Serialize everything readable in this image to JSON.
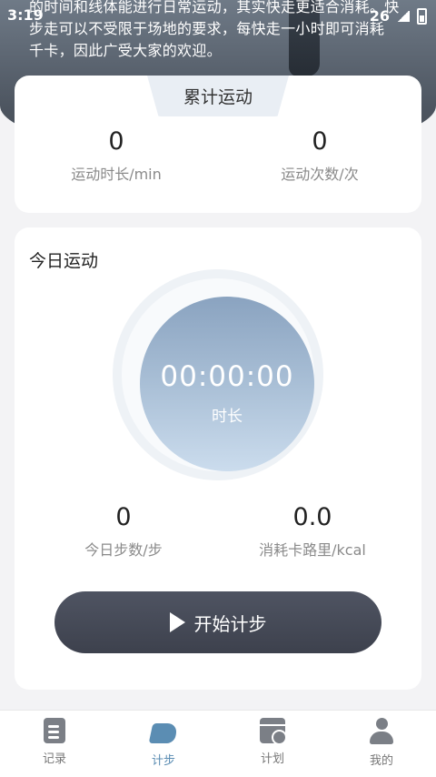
{
  "status_bar": {
    "time": "3:19",
    "signal": "26"
  },
  "hero": {
    "text_line1": "的时间和线体能进行日常运动，其实快走更适合消耗。快",
    "text_line2": "步走可以不受限于场地的要求，每快走一小时即可消耗",
    "text_line3": "千卡，因此广受大家的欢迎。"
  },
  "cumulative": {
    "title": "累计运动",
    "duration_value": "0",
    "duration_label": "运动时长/min",
    "count_value": "0",
    "count_label": "运动次数/次"
  },
  "today": {
    "title": "今日运动",
    "timer": "00:00:00",
    "timer_label": "时长",
    "steps_value": "0",
    "steps_label": "今日步数/步",
    "calories_value": "0.0",
    "calories_label": "消耗卡路里/kcal",
    "start_button": "开始计步"
  },
  "tabbar": {
    "items": [
      {
        "label": "记录",
        "icon": "note-icon"
      },
      {
        "label": "计步",
        "icon": "shoe-icon",
        "active": true
      },
      {
        "label": "计划",
        "icon": "calendar-icon"
      },
      {
        "label": "我的",
        "icon": "user-icon"
      }
    ]
  },
  "colors": {
    "accent": "#5b8db3",
    "button": "#444855",
    "dial_top": "#8aa3c0",
    "dial_bottom": "#cbdced"
  }
}
